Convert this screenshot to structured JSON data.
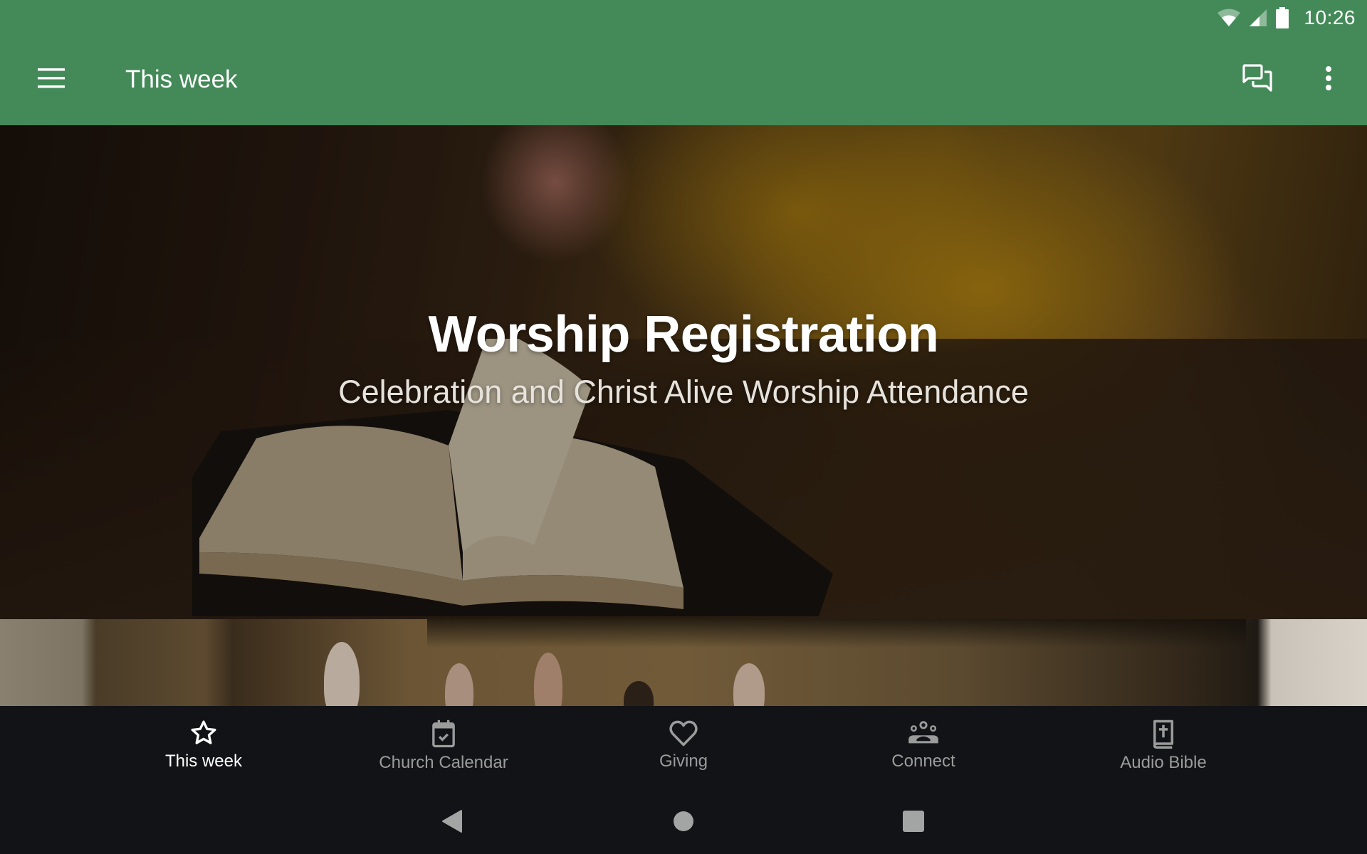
{
  "status_bar": {
    "time": "10:26",
    "icons": [
      "wifi-icon",
      "cellular-signal-icon",
      "battery-icon"
    ]
  },
  "app_bar": {
    "title": "This week",
    "background_color": "#438a58",
    "menu_icon": "hamburger-menu-icon",
    "actions": [
      {
        "name": "chat-icon",
        "label": "Messages"
      },
      {
        "name": "more-vert-icon",
        "label": "More options"
      }
    ]
  },
  "content": {
    "cards": [
      {
        "title": "Worship Registration",
        "subtitle": "Celebration and Christ Alive Worship Attendance",
        "image": "open-bible-photo"
      },
      {
        "title": "",
        "subtitle": "",
        "image": "choir-photo"
      }
    ]
  },
  "bottom_nav": {
    "active_index": 0,
    "items": [
      {
        "label": "This week",
        "icon": "star-icon"
      },
      {
        "label": "Church Calendar",
        "icon": "calendar-check-icon"
      },
      {
        "label": "Giving",
        "icon": "heart-icon"
      },
      {
        "label": "Connect",
        "icon": "groups-icon"
      },
      {
        "label": "Audio Bible",
        "icon": "bible-icon"
      }
    ]
  },
  "system_nav": {
    "buttons": [
      "back",
      "home",
      "recents"
    ]
  }
}
